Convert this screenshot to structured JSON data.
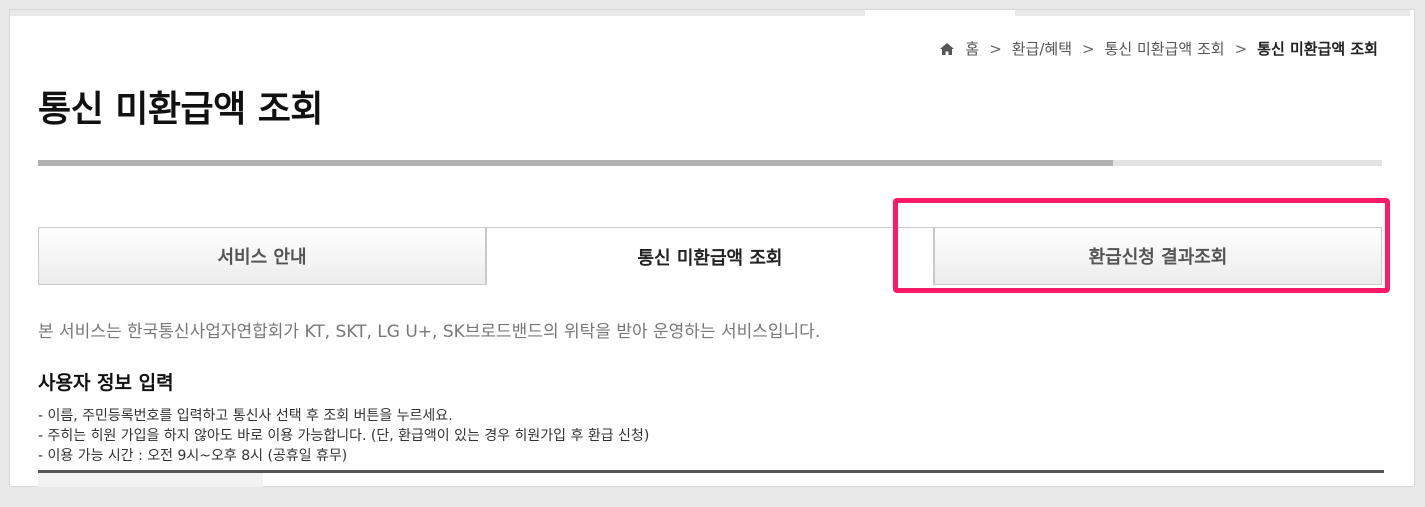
{
  "breadcrumb": {
    "home_icon": "home-icon",
    "items": [
      "홈",
      "환급/혜택",
      "통신 미환급액 조회",
      "통신 미환급액 조회"
    ]
  },
  "page": {
    "title": "통신 미환급액 조회",
    "progress_fraction": 0.8
  },
  "tabs": [
    {
      "label": "서비스 안내",
      "state": "inactive"
    },
    {
      "label": "통신 미환급액 조회",
      "state": "active"
    },
    {
      "label": "환급신청 결과조회",
      "state": "inactive",
      "highlighted": true
    }
  ],
  "highlight_color": "#ff1a66",
  "intro_text": "본 서비스는 한국통신사업자연합회가 KT, SKT, LG U+, SK브로드밴드의 위탁을 받아 운영하는 서비스입니다.",
  "section": {
    "title": "사용자 정보 입력",
    "notes": [
      "- 이름, 주민등록번호를 입력하고 통신사 선택 후 조회 버튼을 누르세요.",
      "- 주히는 히원 가입을 하지 않아도 바로 이용 가능합니다. (단, 환급액이 있는 경우 히원가입 후 환급 신청)",
      "- 이용 가능 시간 : 오전 9시~오후 8시 (공휴일 휴무)"
    ]
  }
}
